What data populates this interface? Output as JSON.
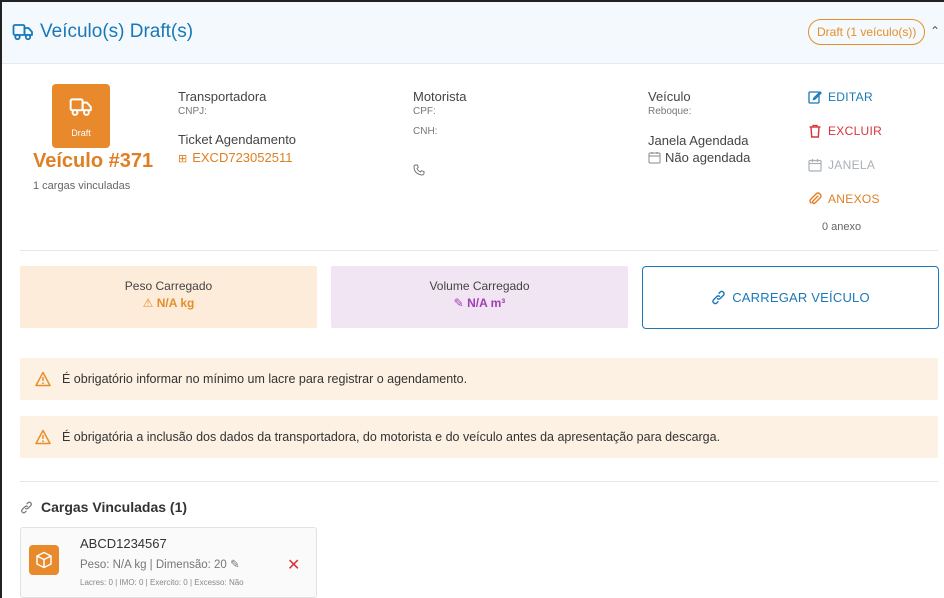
{
  "header": {
    "title": "Veículo(s) Draft(s)",
    "badge": "Draft (1 veículo(s))",
    "collapse_icon": "chevron-up-icon"
  },
  "vehicle": {
    "status": "Draft",
    "number": "Veículo #371",
    "cargas_vinculadas": "1 cargas vinculadas",
    "transportadora_label": "Transportadora",
    "cnpj_label": "CNPJ:",
    "ticket_label": "Ticket Agendamento",
    "ticket_value": "EXCD723052511",
    "motorista_label": "Motorista",
    "cpf_label": "CPF:",
    "cnh_label": "CNH:",
    "veiculo_label": "Veículo",
    "reboque_label": "Reboque:",
    "janela_label": "Janela Agendada",
    "janela_value": "Não agendada"
  },
  "actions": {
    "editar": "EDITAR",
    "excluir": "EXCLUIR",
    "janela": "JANELA",
    "anexos": "ANEXOS",
    "anexo_count": "0 anexo"
  },
  "stats": {
    "peso_label": "Peso Carregado",
    "peso_value": "N/A kg",
    "volume_label": "Volume Carregado",
    "volume_value": "N/A m³",
    "carregar_button": "CARREGAR VEÍCULO"
  },
  "warnings": [
    "É obrigatório informar no mínimo um lacre para registrar o agendamento.",
    "É obrigatória a inclusão dos dados da transportadora, do motorista e do veículo antes da apresentação para descarga."
  ],
  "cargas": {
    "title": "Cargas Vinculadas (1)",
    "items": [
      {
        "code": "ABCD1234567",
        "info": "Peso: N/A kg | Dimensão: 20",
        "meta": "Lacres: 0 | IMO: 0 | Exercito: 0 | Excesso: Não"
      }
    ]
  },
  "colors": {
    "primary": "#1a78b8",
    "accent_orange": "#e8892b",
    "danger": "#d9333a",
    "purple": "#a040b0",
    "warning_bg": "#fcf1e3"
  }
}
